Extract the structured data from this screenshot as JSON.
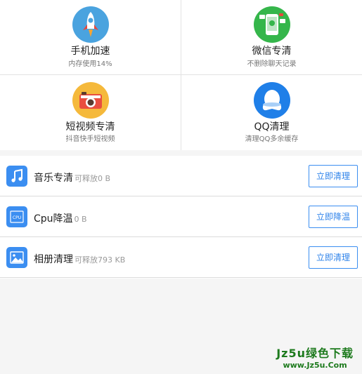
{
  "grid": [
    {
      "title": "手机加速",
      "sub": "内存使用14%",
      "icon": "rocket-icon",
      "color": "#4aa3df"
    },
    {
      "title": "微信专清",
      "sub": "不删除聊天记录",
      "icon": "wechat-phone-icon",
      "color": "#35b64b"
    },
    {
      "title": "短视频专清",
      "sub": "抖音快手短视频",
      "icon": "camera-icon",
      "color": "#f5b93b"
    },
    {
      "title": "QQ清理",
      "sub": "清理QQ多余缓存",
      "icon": "qq-penguin-icon",
      "color": "#1f7fe8"
    }
  ],
  "list": [
    {
      "name": "音乐专清",
      "extra": "可释放0 B",
      "button": "立即清理",
      "icon": "music-note-icon"
    },
    {
      "name": "Cpu降温",
      "extra": "0 B",
      "button": "立即降温",
      "icon": "cpu-chip-icon"
    },
    {
      "name": "相册清理",
      "extra": "可释放793 KB",
      "button": "立即清理",
      "icon": "photo-icon"
    }
  ],
  "watermark": {
    "line1": "Jz5u绿色下载",
    "line2": "www.Jz5u.Com"
  },
  "colors": {
    "accent": "#3b8ef1",
    "watermark": "#1d7a1d"
  }
}
